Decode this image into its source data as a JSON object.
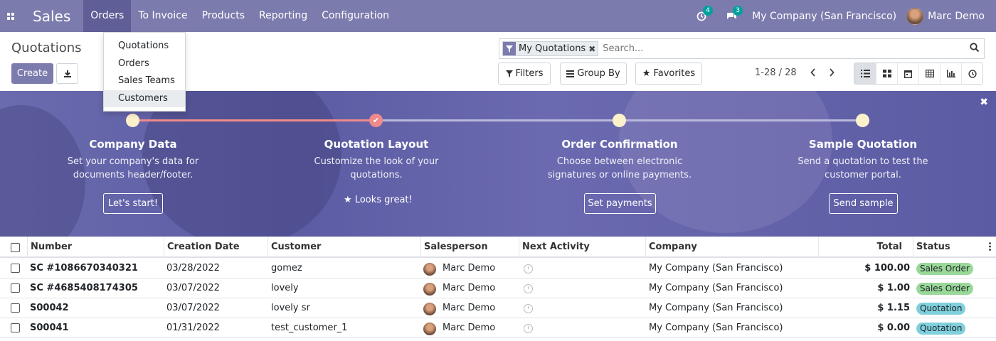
{
  "colors": {
    "brand": "#7c7bad",
    "active_menu": "#5f5e97",
    "notification_badge": "#00a09d",
    "sales_order_badge": "#9ad89a",
    "quotation_badge": "#7fd0dc",
    "step_done": "#f08a8a",
    "step_pending": "#fdf1cc"
  },
  "topbar": {
    "apps_icon": "apps-grid-icon",
    "brand": "Sales",
    "menu": [
      "Orders",
      "To Invoice",
      "Products",
      "Reporting",
      "Configuration"
    ],
    "activity_count": "4",
    "messages_count": "3",
    "company": "My Company (San Francisco)",
    "user": "Marc Demo"
  },
  "dropdown": {
    "items": [
      "Quotations",
      "Orders",
      "Sales Teams",
      "Customers"
    ]
  },
  "control": {
    "title": "Quotations",
    "create": "Create",
    "facet": "My Quotations",
    "search_placeholder": "Search...",
    "filters": "Filters",
    "group_by": "Group By",
    "favorites": "Favorites",
    "pager": "1-28 / 28"
  },
  "banner": {
    "steps": [
      {
        "title": "Company Data",
        "desc1": "Set your company's data for",
        "desc2": "documents header/footer.",
        "button": "Let's start!"
      },
      {
        "title": "Quotation Layout",
        "desc1": "Customize the look of your",
        "desc2": "quotations.",
        "done_text": "Looks great!"
      },
      {
        "title": "Order Confirmation",
        "desc1": "Choose between electronic",
        "desc2": "signatures or online payments.",
        "button": "Set payments"
      },
      {
        "title": "Sample Quotation",
        "desc1": "Send a quotation to test the",
        "desc2": "customer portal.",
        "button": "Send sample"
      }
    ]
  },
  "table": {
    "columns": [
      "Number",
      "Creation Date",
      "Customer",
      "Salesperson",
      "Next Activity",
      "Company",
      "Total",
      "Status"
    ],
    "rows": [
      {
        "number": "SC #1086670340321",
        "date": "03/28/2022",
        "customer": "gomez",
        "salesperson": "Marc Demo",
        "company": "My Company (San Francisco)",
        "total": "$ 100.00",
        "status": "Sales Order"
      },
      {
        "number": "SC #4685408174305",
        "date": "03/07/2022",
        "customer": "lovely",
        "salesperson": "Marc Demo",
        "company": "My Company (San Francisco)",
        "total": "$ 1.00",
        "status": "Sales Order"
      },
      {
        "number": "S00042",
        "date": "03/07/2022",
        "customer": "lovely sr",
        "salesperson": "Marc Demo",
        "company": "My Company (San Francisco)",
        "total": "$ 1.15",
        "status": "Quotation"
      },
      {
        "number": "S00041",
        "date": "01/31/2022",
        "customer": "test_customer_1",
        "salesperson": "Marc Demo",
        "company": "My Company (San Francisco)",
        "total": "$ 0.00",
        "status": "Quotation"
      }
    ]
  }
}
